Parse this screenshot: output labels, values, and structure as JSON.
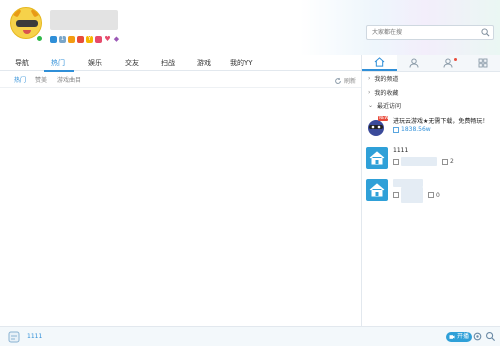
{
  "header": {
    "search_placeholder": "大家都在搜",
    "badges": [
      {
        "icon": "pk-icon",
        "text": "",
        "color": "#2f8fd8"
      },
      {
        "icon": "level-icon",
        "text": "1",
        "color": "#7aa6c9"
      },
      {
        "icon": "badge-orange",
        "text": "",
        "color": "#f39c12"
      },
      {
        "icon": "badge-red",
        "text": "",
        "color": "#e74c3c"
      },
      {
        "icon": "badge-yellow",
        "text": "Y",
        "color": "#f5b800"
      },
      {
        "icon": "badge-red2",
        "text": "",
        "color": "#e64a6b"
      },
      {
        "icon": "heart-icon",
        "text": "",
        "color": "#e64a6b"
      },
      {
        "icon": "diamond-icon",
        "text": "",
        "color": "#9b59b6"
      }
    ]
  },
  "nav": {
    "tabs": [
      "导航",
      "热门",
      "娱乐",
      "交友",
      "扫战",
      "游戏",
      "我的YY"
    ],
    "active": "热门"
  },
  "subnav": {
    "items": [
      "热门",
      "赞美",
      "游戏曲目"
    ],
    "refresh": "刷新"
  },
  "right": {
    "sections": {
      "channels": "我的频道",
      "favorites": "我的收藏",
      "recent": "最近访问"
    },
    "recent": [
      {
        "title": "进玩云游戏★无需下载，免费畅玩！",
        "meta": "1838.56w",
        "badge": "NEW"
      },
      {
        "title": "1111",
        "meta": "2"
      },
      {
        "title": "",
        "meta": "0"
      }
    ]
  },
  "footer": {
    "name": "1111",
    "kaibo": "开播"
  },
  "colors": {
    "accent": "#2f8fd8",
    "badge": "#2fa0d8"
  }
}
